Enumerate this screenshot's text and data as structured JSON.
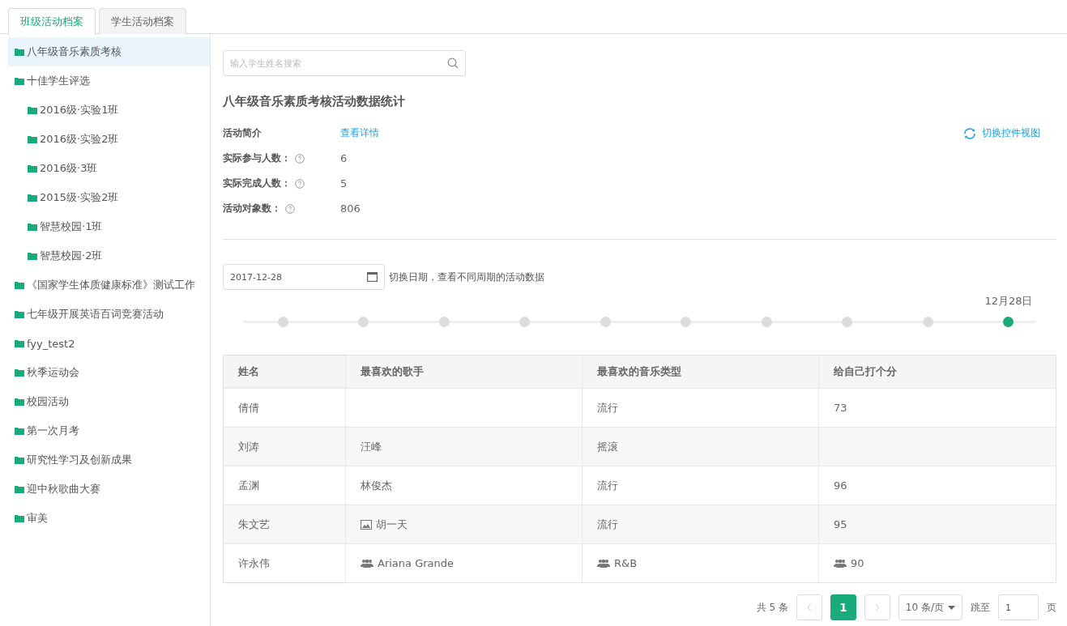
{
  "tabs": [
    {
      "label": "班级活动档案",
      "selected": true
    },
    {
      "label": "学生活动档案",
      "selected": false
    }
  ],
  "sidebar": {
    "items": [
      {
        "label": "八年级音乐素质考核",
        "selected": true
      },
      {
        "label": "十佳学生评选",
        "selected": false,
        "children": [
          {
            "label": "2016级·实验1班",
            "selected": false
          },
          {
            "label": "2016级·实验2班",
            "selected": false
          },
          {
            "label": "2016级·3班",
            "selected": false
          },
          {
            "label": "2015级·实验2班",
            "selected": false
          },
          {
            "label": "智慧校园·1班",
            "selected": false
          },
          {
            "label": "智慧校园·2班",
            "selected": false
          }
        ]
      },
      {
        "label": "《国家学生体质健康标准》测试工作",
        "selected": false
      },
      {
        "label": "七年级开展英语百词竞赛活动",
        "selected": false
      },
      {
        "label": "fyy_test2",
        "selected": false
      },
      {
        "label": "秋季运动会",
        "selected": false
      },
      {
        "label": "校园活动",
        "selected": false
      },
      {
        "label": "第一次月考",
        "selected": false
      },
      {
        "label": "研究性学习及创新成果",
        "selected": false
      },
      {
        "label": "迎中秋歌曲大赛",
        "selected": false
      },
      {
        "label": "审美",
        "selected": false
      }
    ]
  },
  "search": {
    "placeholder": "输入学生姓名搜索"
  },
  "title": "八年级音乐素质考核活动数据统计",
  "intro": {
    "label": "活动简介",
    "link": "查看详情"
  },
  "switch_view": "切换控件视图",
  "stats": [
    {
      "label": "实际参与人数：",
      "value": "6"
    },
    {
      "label": "实际完成人数：",
      "value": "5"
    },
    {
      "label": "活动对象数：",
      "value": "806"
    }
  ],
  "date": {
    "value": "2017-12-28",
    "hint": "切换日期，查看不同周期的活动数据"
  },
  "timeline": {
    "label": "12月28日",
    "points": [
      {
        "selected": false
      },
      {
        "selected": false
      },
      {
        "selected": false
      },
      {
        "selected": false
      },
      {
        "selected": false
      },
      {
        "selected": false
      },
      {
        "selected": false
      },
      {
        "selected": false
      },
      {
        "selected": false
      },
      {
        "selected": true
      }
    ]
  },
  "table": {
    "columns": [
      "姓名",
      "最喜欢的歌手",
      "最喜欢的音乐类型",
      "给自己打个分"
    ],
    "rows": [
      [
        {
          "text": "倩倩"
        },
        null,
        {
          "text": "流行"
        },
        {
          "text": "73"
        }
      ],
      [
        {
          "text": "刘涛"
        },
        {
          "text": "汪峰"
        },
        {
          "text": "摇滚"
        },
        null
      ],
      [
        {
          "text": "孟渊"
        },
        {
          "text": "林俊杰"
        },
        {
          "text": "流行"
        },
        {
          "text": "96"
        }
      ],
      [
        {
          "text": "朱文艺"
        },
        {
          "text": "胡一天",
          "kind": "image"
        },
        {
          "text": "流行"
        },
        {
          "text": "95"
        }
      ],
      [
        {
          "text": "许永伟"
        },
        {
          "text": "Ariana Grande",
          "kind": "people"
        },
        {
          "text": "R&B",
          "kind": "people"
        },
        {
          "text": "90",
          "kind": "people"
        }
      ]
    ]
  },
  "pagination": {
    "total": "共 5 条",
    "pages": [
      {
        "label": "1",
        "selected": true
      }
    ],
    "page_size": "10 条/页",
    "jump_label": "跳至",
    "jump_value": "1",
    "suffix": "页"
  }
}
